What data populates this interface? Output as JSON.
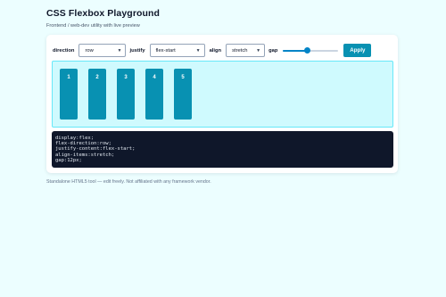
{
  "header": {
    "title": "CSS Flexbox Playground",
    "subtitle": "Frontend / web-dev utility with live preview"
  },
  "controls": {
    "direction_label": "direction",
    "direction_value": "row",
    "justify_label": "justify",
    "justify_value": "flex-start",
    "align_label": "align",
    "align_value": "stretch",
    "gap_label": "gap",
    "gap_fraction": 0.44,
    "apply_label": "Apply"
  },
  "preview": {
    "items": [
      "1",
      "2",
      "3",
      "4",
      "5"
    ]
  },
  "code_lines": [
    "display:flex;",
    "flex-direction:row;",
    "justify-content:flex-start;",
    "align-items:stretch;",
    "gap:12px;"
  ],
  "footer": {
    "text": "Standalone HTML5 tool — edit freely. Not affiliated with any framework vendor."
  },
  "colors": {
    "page_bg": "#ecfeff",
    "accent": "#0891b2",
    "preview_bg": "#cffafe",
    "code_bg": "#0f172a",
    "slider": "#0284c7"
  }
}
